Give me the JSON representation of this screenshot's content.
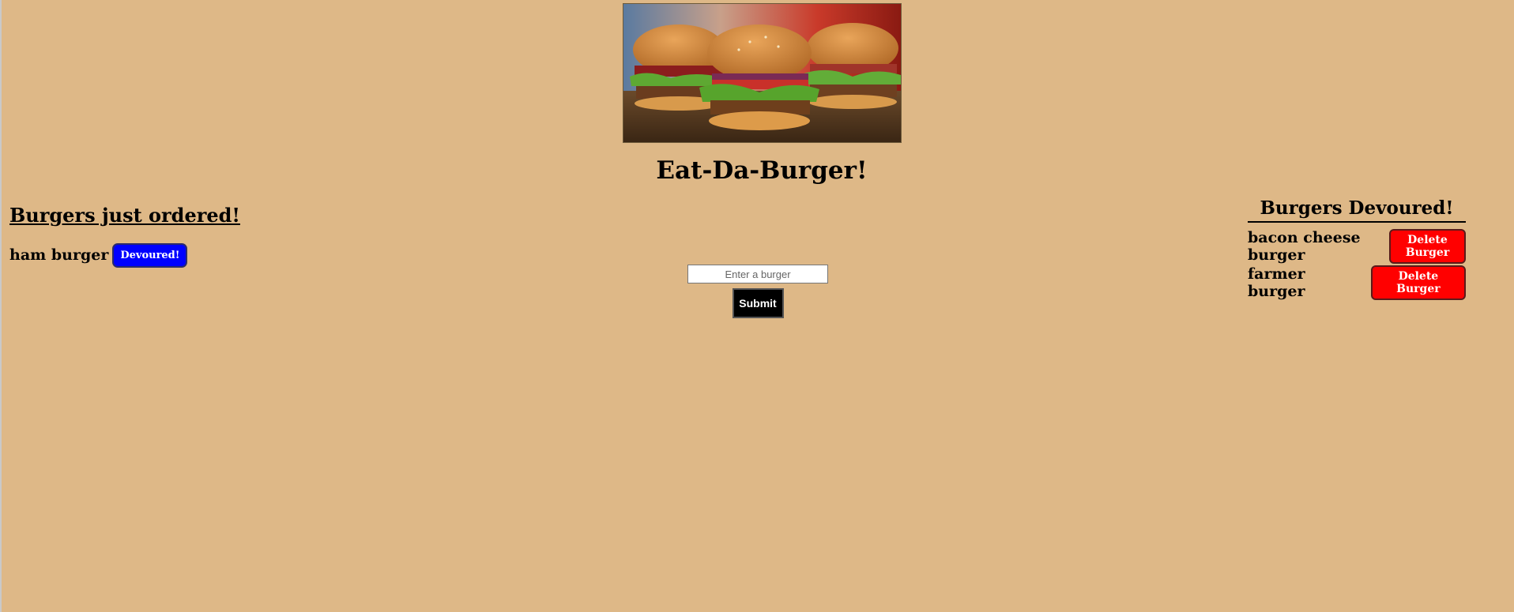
{
  "header": {
    "title": "Eat-Da-Burger!"
  },
  "ordered": {
    "heading": "Burgers just ordered!",
    "items": [
      {
        "name": "ham burger",
        "button_label": "Devoured!"
      }
    ]
  },
  "form": {
    "placeholder": "Enter a burger",
    "value": "",
    "submit_label": "Submit"
  },
  "devoured": {
    "heading": "Burgers Devoured!",
    "items": [
      {
        "name": "bacon cheese burger",
        "button_label": "Delete Burger"
      },
      {
        "name": "farmer burger",
        "button_label": "Delete Burger"
      }
    ]
  },
  "colors": {
    "background": "#deb887",
    "devour_button": "#0000ff",
    "delete_button": "#ff0000",
    "submit_button": "#000000"
  }
}
